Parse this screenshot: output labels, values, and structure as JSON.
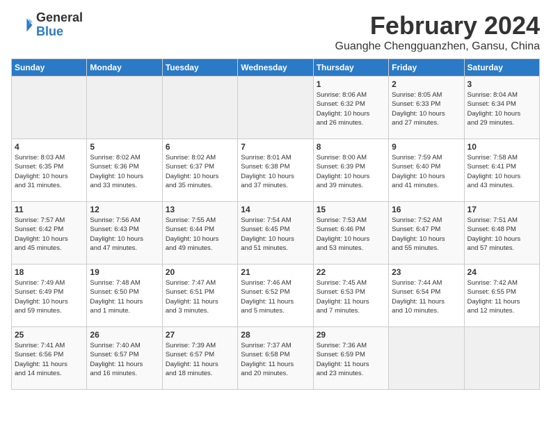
{
  "logo": {
    "general": "General",
    "blue": "Blue"
  },
  "title": "February 2024",
  "subtitle": "Guanghe Chengguanzhen, Gansu, China",
  "days_header": [
    "Sunday",
    "Monday",
    "Tuesday",
    "Wednesday",
    "Thursday",
    "Friday",
    "Saturday"
  ],
  "weeks": [
    [
      {
        "day": "",
        "info": ""
      },
      {
        "day": "",
        "info": ""
      },
      {
        "day": "",
        "info": ""
      },
      {
        "day": "",
        "info": ""
      },
      {
        "day": "1",
        "info": "Sunrise: 8:06 AM\nSunset: 6:32 PM\nDaylight: 10 hours\nand 26 minutes."
      },
      {
        "day": "2",
        "info": "Sunrise: 8:05 AM\nSunset: 6:33 PM\nDaylight: 10 hours\nand 27 minutes."
      },
      {
        "day": "3",
        "info": "Sunrise: 8:04 AM\nSunset: 6:34 PM\nDaylight: 10 hours\nand 29 minutes."
      }
    ],
    [
      {
        "day": "4",
        "info": "Sunrise: 8:03 AM\nSunset: 6:35 PM\nDaylight: 10 hours\nand 31 minutes."
      },
      {
        "day": "5",
        "info": "Sunrise: 8:02 AM\nSunset: 6:36 PM\nDaylight: 10 hours\nand 33 minutes."
      },
      {
        "day": "6",
        "info": "Sunrise: 8:02 AM\nSunset: 6:37 PM\nDaylight: 10 hours\nand 35 minutes."
      },
      {
        "day": "7",
        "info": "Sunrise: 8:01 AM\nSunset: 6:38 PM\nDaylight: 10 hours\nand 37 minutes."
      },
      {
        "day": "8",
        "info": "Sunrise: 8:00 AM\nSunset: 6:39 PM\nDaylight: 10 hours\nand 39 minutes."
      },
      {
        "day": "9",
        "info": "Sunrise: 7:59 AM\nSunset: 6:40 PM\nDaylight: 10 hours\nand 41 minutes."
      },
      {
        "day": "10",
        "info": "Sunrise: 7:58 AM\nSunset: 6:41 PM\nDaylight: 10 hours\nand 43 minutes."
      }
    ],
    [
      {
        "day": "11",
        "info": "Sunrise: 7:57 AM\nSunset: 6:42 PM\nDaylight: 10 hours\nand 45 minutes."
      },
      {
        "day": "12",
        "info": "Sunrise: 7:56 AM\nSunset: 6:43 PM\nDaylight: 10 hours\nand 47 minutes."
      },
      {
        "day": "13",
        "info": "Sunrise: 7:55 AM\nSunset: 6:44 PM\nDaylight: 10 hours\nand 49 minutes."
      },
      {
        "day": "14",
        "info": "Sunrise: 7:54 AM\nSunset: 6:45 PM\nDaylight: 10 hours\nand 51 minutes."
      },
      {
        "day": "15",
        "info": "Sunrise: 7:53 AM\nSunset: 6:46 PM\nDaylight: 10 hours\nand 53 minutes."
      },
      {
        "day": "16",
        "info": "Sunrise: 7:52 AM\nSunset: 6:47 PM\nDaylight: 10 hours\nand 55 minutes."
      },
      {
        "day": "17",
        "info": "Sunrise: 7:51 AM\nSunset: 6:48 PM\nDaylight: 10 hours\nand 57 minutes."
      }
    ],
    [
      {
        "day": "18",
        "info": "Sunrise: 7:49 AM\nSunset: 6:49 PM\nDaylight: 10 hours\nand 59 minutes."
      },
      {
        "day": "19",
        "info": "Sunrise: 7:48 AM\nSunset: 6:50 PM\nDaylight: 11 hours\nand 1 minute."
      },
      {
        "day": "20",
        "info": "Sunrise: 7:47 AM\nSunset: 6:51 PM\nDaylight: 11 hours\nand 3 minutes."
      },
      {
        "day": "21",
        "info": "Sunrise: 7:46 AM\nSunset: 6:52 PM\nDaylight: 11 hours\nand 5 minutes."
      },
      {
        "day": "22",
        "info": "Sunrise: 7:45 AM\nSunset: 6:53 PM\nDaylight: 11 hours\nand 7 minutes."
      },
      {
        "day": "23",
        "info": "Sunrise: 7:44 AM\nSunset: 6:54 PM\nDaylight: 11 hours\nand 10 minutes."
      },
      {
        "day": "24",
        "info": "Sunrise: 7:42 AM\nSunset: 6:55 PM\nDaylight: 11 hours\nand 12 minutes."
      }
    ],
    [
      {
        "day": "25",
        "info": "Sunrise: 7:41 AM\nSunset: 6:56 PM\nDaylight: 11 hours\nand 14 minutes."
      },
      {
        "day": "26",
        "info": "Sunrise: 7:40 AM\nSunset: 6:57 PM\nDaylight: 11 hours\nand 16 minutes."
      },
      {
        "day": "27",
        "info": "Sunrise: 7:39 AM\nSunset: 6:57 PM\nDaylight: 11 hours\nand 18 minutes."
      },
      {
        "day": "28",
        "info": "Sunrise: 7:37 AM\nSunset: 6:58 PM\nDaylight: 11 hours\nand 20 minutes."
      },
      {
        "day": "29",
        "info": "Sunrise: 7:36 AM\nSunset: 6:59 PM\nDaylight: 11 hours\nand 23 minutes."
      },
      {
        "day": "",
        "info": ""
      },
      {
        "day": "",
        "info": ""
      }
    ]
  ]
}
